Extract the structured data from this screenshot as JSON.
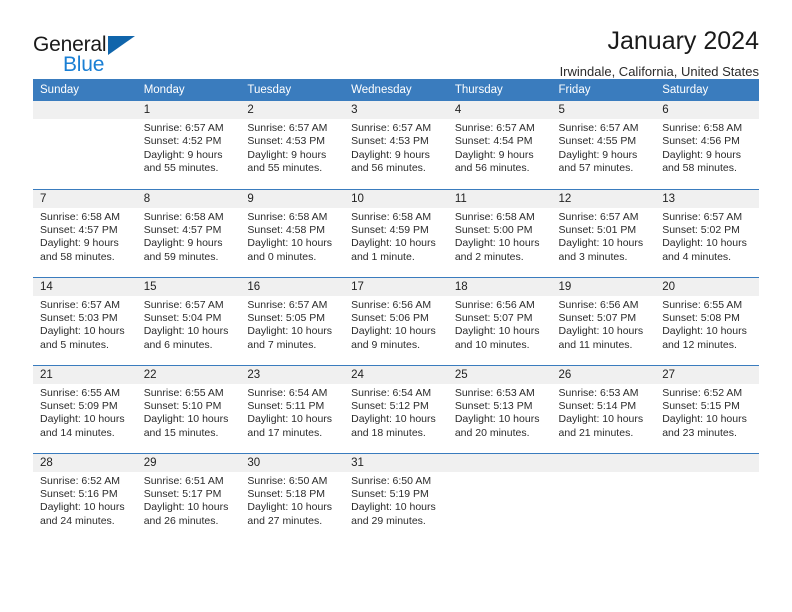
{
  "brand": {
    "name_top": "General",
    "name_bottom": "Blue",
    "triangle_icon": "triangle-icon"
  },
  "header": {
    "title": "January 2024",
    "subtitle": "Irwindale, California, United States"
  },
  "colors": {
    "header_blue": "#3a7cbe",
    "brand_blue": "#1a7fd4",
    "triangle_blue": "#1065ab",
    "daynum_band": "#f0f0f0"
  },
  "calendar": {
    "weekday_headers": [
      "Sunday",
      "Monday",
      "Tuesday",
      "Wednesday",
      "Thursday",
      "Friday",
      "Saturday"
    ],
    "weeks": [
      [
        {
          "day": "",
          "sunrise": "",
          "sunset": "",
          "daylight": ""
        },
        {
          "day": "1",
          "sunrise": "Sunrise: 6:57 AM",
          "sunset": "Sunset: 4:52 PM",
          "daylight": "Daylight: 9 hours and 55 minutes."
        },
        {
          "day": "2",
          "sunrise": "Sunrise: 6:57 AM",
          "sunset": "Sunset: 4:53 PM",
          "daylight": "Daylight: 9 hours and 55 minutes."
        },
        {
          "day": "3",
          "sunrise": "Sunrise: 6:57 AM",
          "sunset": "Sunset: 4:53 PM",
          "daylight": "Daylight: 9 hours and 56 minutes."
        },
        {
          "day": "4",
          "sunrise": "Sunrise: 6:57 AM",
          "sunset": "Sunset: 4:54 PM",
          "daylight": "Daylight: 9 hours and 56 minutes."
        },
        {
          "day": "5",
          "sunrise": "Sunrise: 6:57 AM",
          "sunset": "Sunset: 4:55 PM",
          "daylight": "Daylight: 9 hours and 57 minutes."
        },
        {
          "day": "6",
          "sunrise": "Sunrise: 6:58 AM",
          "sunset": "Sunset: 4:56 PM",
          "daylight": "Daylight: 9 hours and 58 minutes."
        }
      ],
      [
        {
          "day": "7",
          "sunrise": "Sunrise: 6:58 AM",
          "sunset": "Sunset: 4:57 PM",
          "daylight": "Daylight: 9 hours and 58 minutes."
        },
        {
          "day": "8",
          "sunrise": "Sunrise: 6:58 AM",
          "sunset": "Sunset: 4:57 PM",
          "daylight": "Daylight: 9 hours and 59 minutes."
        },
        {
          "day": "9",
          "sunrise": "Sunrise: 6:58 AM",
          "sunset": "Sunset: 4:58 PM",
          "daylight": "Daylight: 10 hours and 0 minutes."
        },
        {
          "day": "10",
          "sunrise": "Sunrise: 6:58 AM",
          "sunset": "Sunset: 4:59 PM",
          "daylight": "Daylight: 10 hours and 1 minute."
        },
        {
          "day": "11",
          "sunrise": "Sunrise: 6:58 AM",
          "sunset": "Sunset: 5:00 PM",
          "daylight": "Daylight: 10 hours and 2 minutes."
        },
        {
          "day": "12",
          "sunrise": "Sunrise: 6:57 AM",
          "sunset": "Sunset: 5:01 PM",
          "daylight": "Daylight: 10 hours and 3 minutes."
        },
        {
          "day": "13",
          "sunrise": "Sunrise: 6:57 AM",
          "sunset": "Sunset: 5:02 PM",
          "daylight": "Daylight: 10 hours and 4 minutes."
        }
      ],
      [
        {
          "day": "14",
          "sunrise": "Sunrise: 6:57 AM",
          "sunset": "Sunset: 5:03 PM",
          "daylight": "Daylight: 10 hours and 5 minutes."
        },
        {
          "day": "15",
          "sunrise": "Sunrise: 6:57 AM",
          "sunset": "Sunset: 5:04 PM",
          "daylight": "Daylight: 10 hours and 6 minutes."
        },
        {
          "day": "16",
          "sunrise": "Sunrise: 6:57 AM",
          "sunset": "Sunset: 5:05 PM",
          "daylight": "Daylight: 10 hours and 7 minutes."
        },
        {
          "day": "17",
          "sunrise": "Sunrise: 6:56 AM",
          "sunset": "Sunset: 5:06 PM",
          "daylight": "Daylight: 10 hours and 9 minutes."
        },
        {
          "day": "18",
          "sunrise": "Sunrise: 6:56 AM",
          "sunset": "Sunset: 5:07 PM",
          "daylight": "Daylight: 10 hours and 10 minutes."
        },
        {
          "day": "19",
          "sunrise": "Sunrise: 6:56 AM",
          "sunset": "Sunset: 5:07 PM",
          "daylight": "Daylight: 10 hours and 11 minutes."
        },
        {
          "day": "20",
          "sunrise": "Sunrise: 6:55 AM",
          "sunset": "Sunset: 5:08 PM",
          "daylight": "Daylight: 10 hours and 12 minutes."
        }
      ],
      [
        {
          "day": "21",
          "sunrise": "Sunrise: 6:55 AM",
          "sunset": "Sunset: 5:09 PM",
          "daylight": "Daylight: 10 hours and 14 minutes."
        },
        {
          "day": "22",
          "sunrise": "Sunrise: 6:55 AM",
          "sunset": "Sunset: 5:10 PM",
          "daylight": "Daylight: 10 hours and 15 minutes."
        },
        {
          "day": "23",
          "sunrise": "Sunrise: 6:54 AM",
          "sunset": "Sunset: 5:11 PM",
          "daylight": "Daylight: 10 hours and 17 minutes."
        },
        {
          "day": "24",
          "sunrise": "Sunrise: 6:54 AM",
          "sunset": "Sunset: 5:12 PM",
          "daylight": "Daylight: 10 hours and 18 minutes."
        },
        {
          "day": "25",
          "sunrise": "Sunrise: 6:53 AM",
          "sunset": "Sunset: 5:13 PM",
          "daylight": "Daylight: 10 hours and 20 minutes."
        },
        {
          "day": "26",
          "sunrise": "Sunrise: 6:53 AM",
          "sunset": "Sunset: 5:14 PM",
          "daylight": "Daylight: 10 hours and 21 minutes."
        },
        {
          "day": "27",
          "sunrise": "Sunrise: 6:52 AM",
          "sunset": "Sunset: 5:15 PM",
          "daylight": "Daylight: 10 hours and 23 minutes."
        }
      ],
      [
        {
          "day": "28",
          "sunrise": "Sunrise: 6:52 AM",
          "sunset": "Sunset: 5:16 PM",
          "daylight": "Daylight: 10 hours and 24 minutes."
        },
        {
          "day": "29",
          "sunrise": "Sunrise: 6:51 AM",
          "sunset": "Sunset: 5:17 PM",
          "daylight": "Daylight: 10 hours and 26 minutes."
        },
        {
          "day": "30",
          "sunrise": "Sunrise: 6:50 AM",
          "sunset": "Sunset: 5:18 PM",
          "daylight": "Daylight: 10 hours and 27 minutes."
        },
        {
          "day": "31",
          "sunrise": "Sunrise: 6:50 AM",
          "sunset": "Sunset: 5:19 PM",
          "daylight": "Daylight: 10 hours and 29 minutes."
        },
        {
          "day": "",
          "sunrise": "",
          "sunset": "",
          "daylight": ""
        },
        {
          "day": "",
          "sunrise": "",
          "sunset": "",
          "daylight": ""
        },
        {
          "day": "",
          "sunrise": "",
          "sunset": "",
          "daylight": ""
        }
      ]
    ]
  }
}
